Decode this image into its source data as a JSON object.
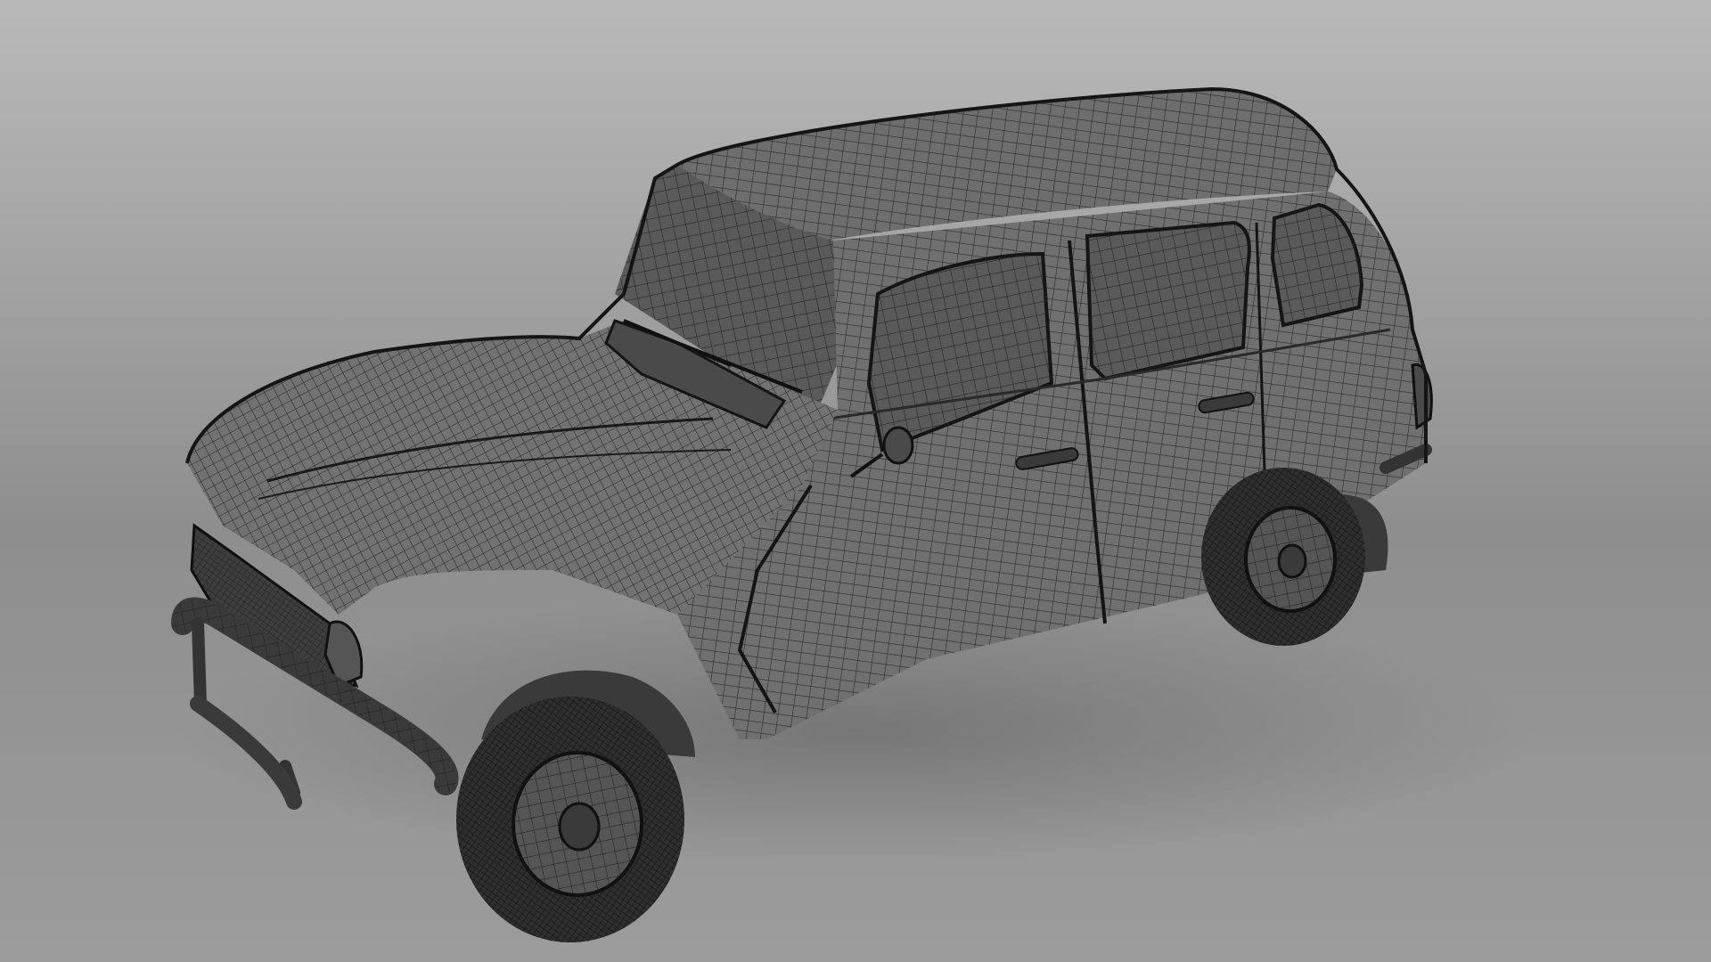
{
  "scene": {
    "subject": "wireframe-hatchback-car",
    "render_style": "mesh-wireframe",
    "colors": {
      "bg_top": "#b9b9b9",
      "bg_mid": "#8e8e8e",
      "bg_bottom": "#9c9c9c",
      "body": "#6e6e6e",
      "body_dark": "#555555",
      "glass": "#5a5a5a",
      "tire": "#2e2e2e",
      "rim": "#555555",
      "wire": "#1e1e1e",
      "shadow": "#7a7a7a"
    }
  }
}
